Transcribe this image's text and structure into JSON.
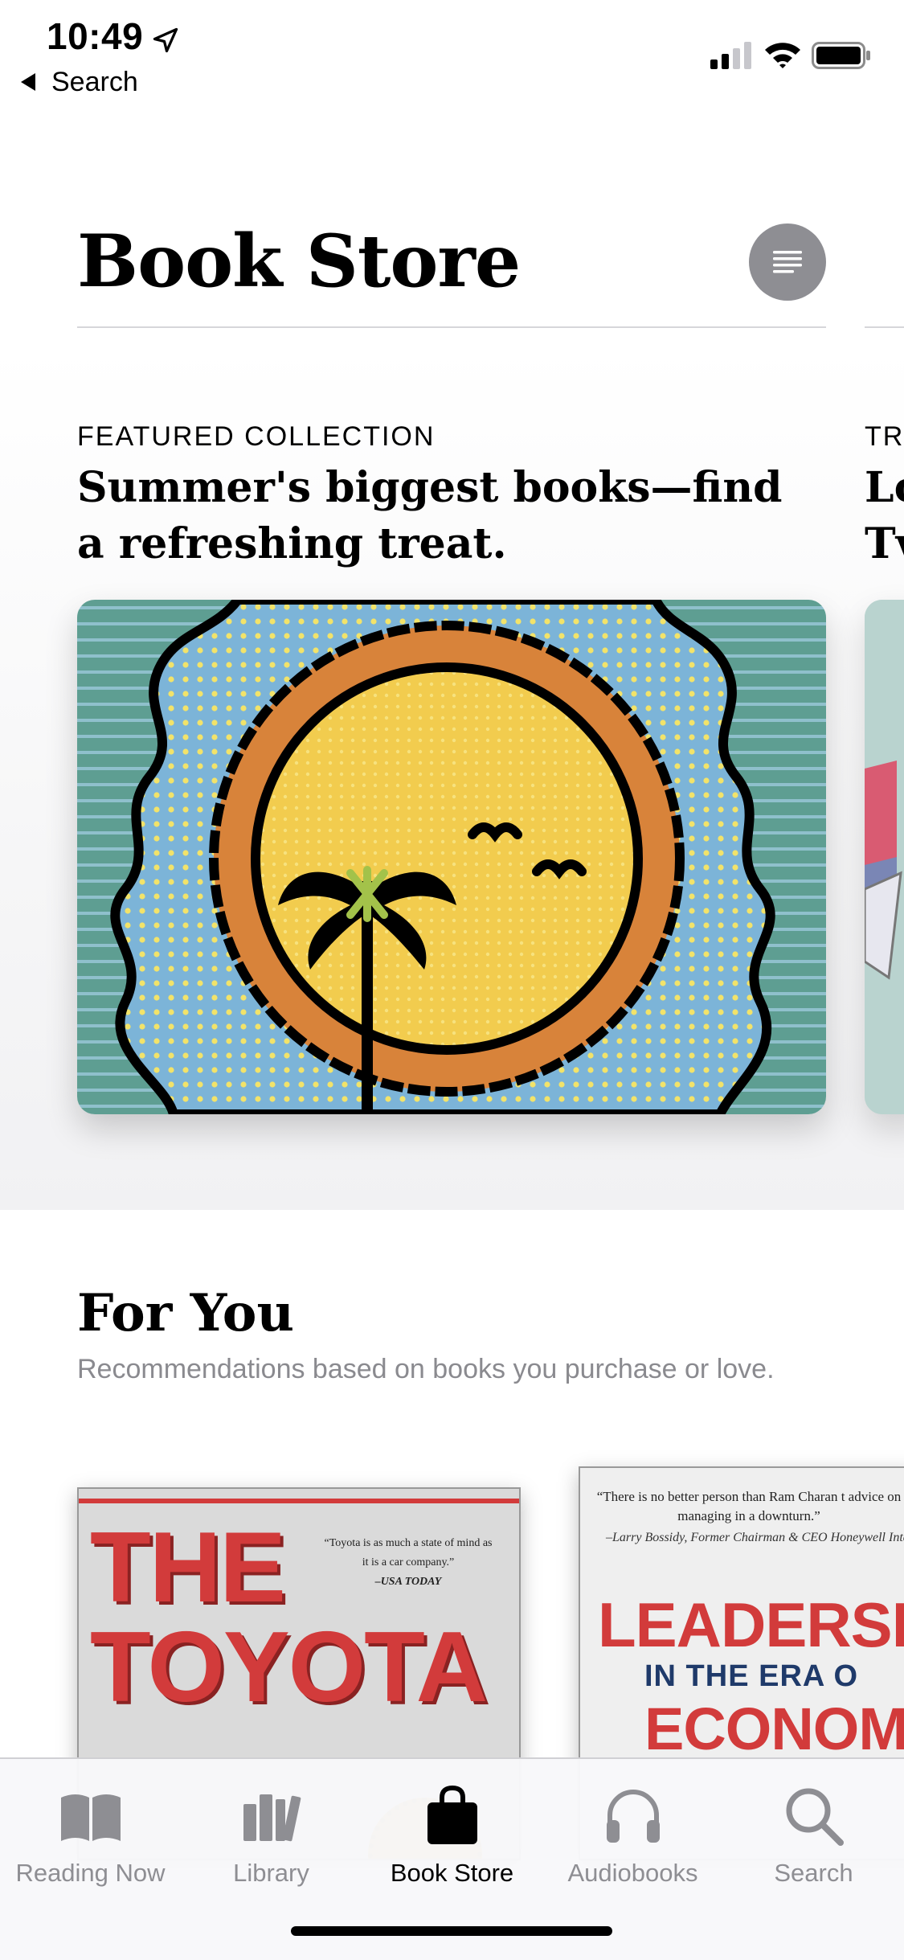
{
  "status_bar": {
    "time": "10:49",
    "back_label": "Search"
  },
  "header": {
    "title": "Book Store"
  },
  "featured": {
    "eyebrow": "FEATURED COLLECTION",
    "headline": "Summer's biggest books—find a refreshing treat.",
    "peek_eyebrow": "TR",
    "peek_headline_line1": "Lo",
    "peek_headline_line2": "Tv"
  },
  "for_you": {
    "title": "For You",
    "subtitle": "Recommendations based on books you purchase or love.",
    "books": [
      {
        "title_line1": "THE",
        "title_line2": "TOYOTA",
        "quote": "“Toyota is as much a state of mind as it is a car company.”",
        "quote_source": "–USA TODAY"
      },
      {
        "quote": "“There is no better person than Ram Charan t advice on managing in a downturn.”",
        "quote_source": "–Larry Bossidy, Former Chairman & CEO Honeywell Inte",
        "title_line1": "LEADERSH",
        "title_line2": "IN THE ERA O",
        "title_line3": "ECONOMIC"
      }
    ]
  },
  "tabbar": {
    "tabs": [
      {
        "label": "Reading Now",
        "icon": "book-open-icon",
        "active": false
      },
      {
        "label": "Library",
        "icon": "library-icon",
        "active": false
      },
      {
        "label": "Book Store",
        "icon": "shopping-bag-icon",
        "active": true
      },
      {
        "label": "Audiobooks",
        "icon": "headphones-icon",
        "active": false
      },
      {
        "label": "Search",
        "icon": "magnifier-icon",
        "active": false
      }
    ]
  },
  "colors": {
    "accent_inactive": "#8e8e93",
    "hero_teal": "#5e9e92",
    "hero_blue": "#7cb4d8",
    "hero_orange": "#d8833a",
    "hero_sun": "#f2cc4e",
    "book_red": "#d23b3b"
  }
}
